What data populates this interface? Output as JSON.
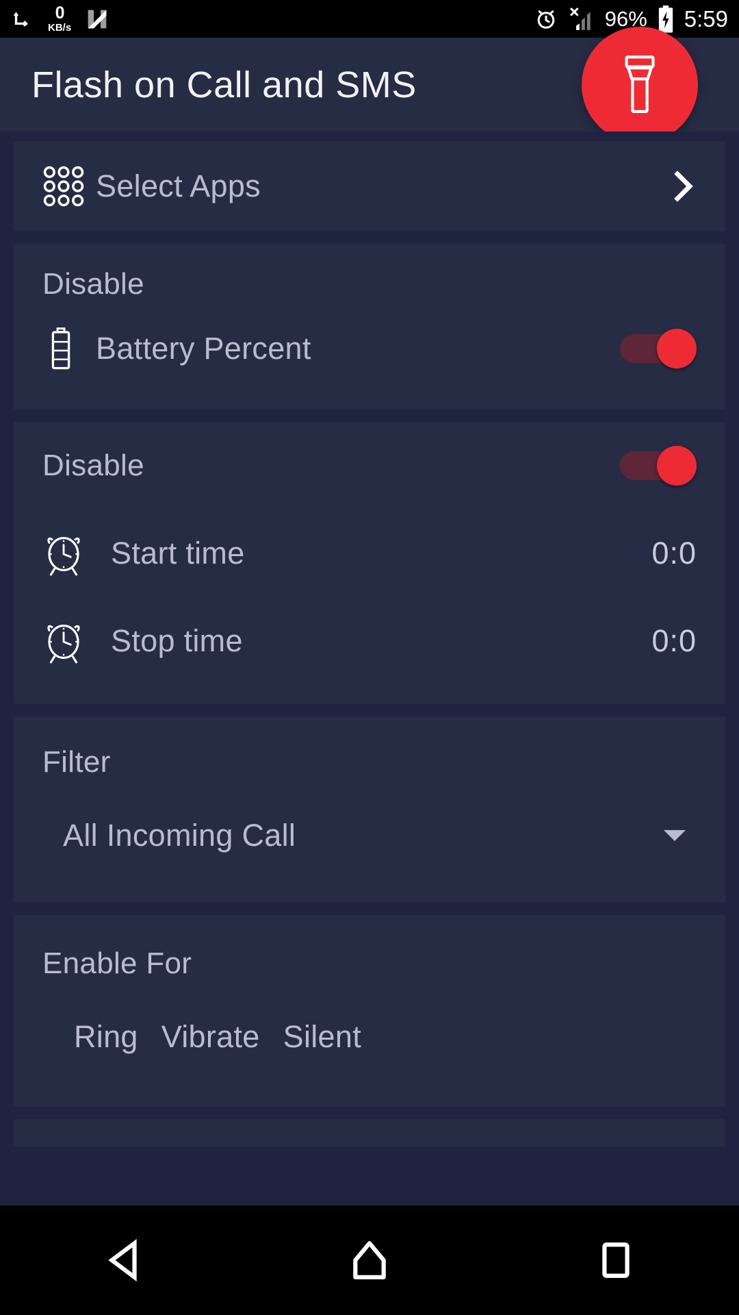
{
  "status_bar": {
    "download_icon": "download-arrow-icon",
    "net_speed_value": "0",
    "net_speed_unit": "KB/s",
    "nougat_logo": "N",
    "alarm_icon": "alarm-clock-icon",
    "signal_icon": "signal-no-sim-icon",
    "battery_percent": "96%",
    "battery_icon": "battery-charging-icon",
    "clock": "5:59"
  },
  "app_bar": {
    "title": "Flash on Call and SMS",
    "fab_icon": "flashlight-icon",
    "fab_color": "#ee2b35"
  },
  "select_apps": {
    "icon": "apps-grid-icon",
    "label": "Select Apps",
    "chevron": "chevron-right-icon"
  },
  "battery_section": {
    "header": "Disable",
    "row": {
      "icon": "battery-icon",
      "label": "Battery Percent",
      "toggle_on": true
    }
  },
  "schedule_section": {
    "header": "Disable",
    "toggle_on": true,
    "rows": [
      {
        "icon": "alarm-clock-icon",
        "label": "Start time",
        "value": "0:0"
      },
      {
        "icon": "alarm-clock-icon",
        "label": "Stop time",
        "value": "0:0"
      }
    ]
  },
  "filter_section": {
    "header": "Filter",
    "selected": "All Incoming Call",
    "caret": "chevron-down-icon"
  },
  "enable_for_section": {
    "header": "Enable For",
    "options": [
      "Ring",
      "Vibrate",
      "Silent"
    ]
  },
  "nav_bar": {
    "back": "back-triangle-icon",
    "home": "home-icon",
    "recents": "recents-square-icon"
  },
  "colors": {
    "background": "#1f2340",
    "card": "#272c45",
    "accent": "#ee2b35",
    "track": "#5e2636",
    "text": "#b9bcd0"
  }
}
